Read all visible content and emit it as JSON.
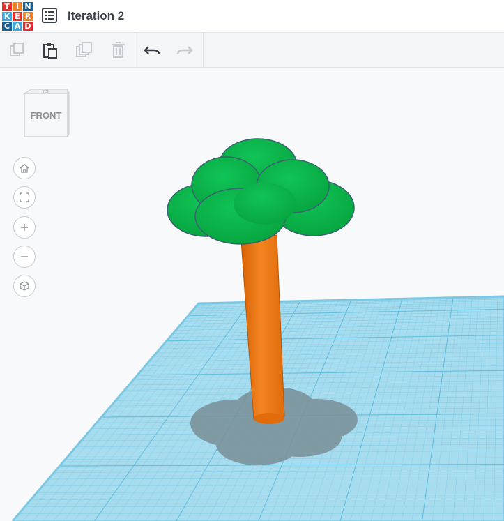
{
  "app": {
    "logo_letters": [
      "T",
      "I",
      "N",
      "K",
      "E",
      "R",
      "C",
      "A",
      "D"
    ],
    "logo_colors": [
      "#e2302e",
      "#f07f25",
      "#1a5f94",
      "#3aa6dd",
      "#e2302e",
      "#f07f25",
      "#1a5f94",
      "#3aa6dd",
      "#e2302e"
    ],
    "title": "Iteration 2"
  },
  "toolbar": {
    "tools": [
      {
        "name": "copy-icon",
        "enabled": false
      },
      {
        "name": "paste-icon",
        "enabled": true
      },
      {
        "name": "duplicate-icon",
        "enabled": false
      },
      {
        "name": "delete-icon",
        "enabled": false
      },
      {
        "name": "undo-icon",
        "enabled": true
      },
      {
        "name": "redo-icon",
        "enabled": false
      }
    ]
  },
  "viewcube": {
    "face_label": "FRONT",
    "top_label": "TOP"
  },
  "nav_controls": [
    "home-view-icon",
    "fit-view-icon",
    "zoom-in-icon",
    "zoom-out-icon",
    "perspective-icon"
  ],
  "colors": {
    "workplane": "#a7dcef",
    "grid_line": "#5bbcdc",
    "foliage": "#0cb24a",
    "trunk": "#f07a0e",
    "shadow": "#7a8f98"
  }
}
